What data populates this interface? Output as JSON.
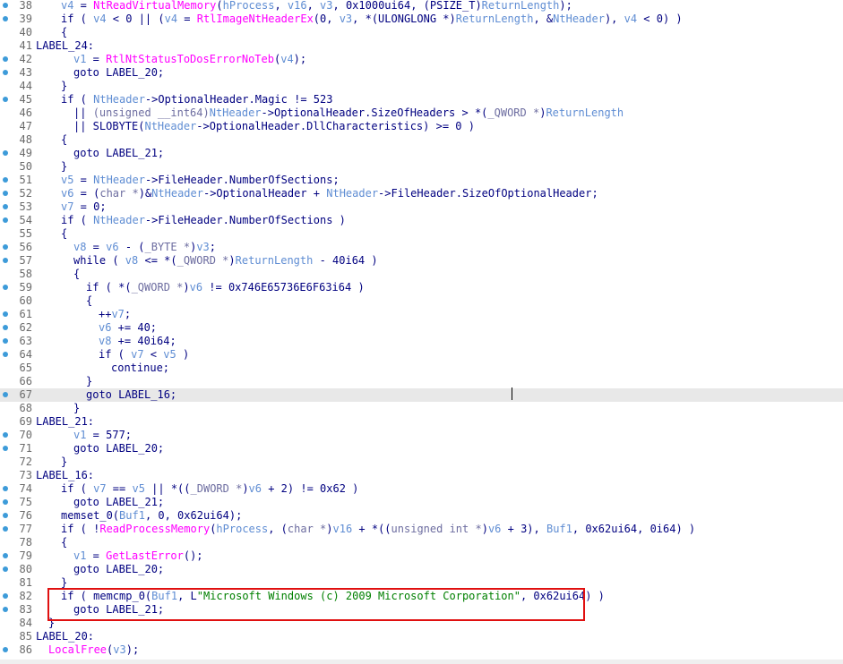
{
  "colors": {
    "keyword": "#000080",
    "variable": "#5f8dd3",
    "function": "#ff00ff",
    "string": "#008000",
    "breakpoint": "#3d9bd9",
    "highlight_box": "#e01010",
    "current_line": "#e8e8e8"
  },
  "icons": {
    "breakpoint": "breakpoint-dot-icon",
    "caret": "text-caret"
  },
  "annotation": {
    "type": "red-rectangle",
    "covers_lines": [
      "82",
      "83"
    ]
  },
  "current_line": "67",
  "lines": [
    {
      "num": "38",
      "bp": true,
      "indent": 2,
      "segs": [
        [
          "v",
          "v4"
        ],
        [
          "k",
          " = "
        ],
        [
          "f",
          "NtReadVirtualMemory"
        ],
        [
          "k",
          "("
        ],
        [
          "v",
          "hProcess"
        ],
        [
          "k",
          ", "
        ],
        [
          "v",
          "v16"
        ],
        [
          "k",
          ", "
        ],
        [
          "v",
          "v3"
        ],
        [
          "k",
          ", 0x1000ui64, (PSIZE_T)"
        ],
        [
          "v",
          "ReturnLength"
        ],
        [
          "k",
          ");"
        ]
      ]
    },
    {
      "num": "39",
      "bp": true,
      "indent": 2,
      "segs": [
        [
          "k",
          "if ( "
        ],
        [
          "v",
          "v4"
        ],
        [
          "k",
          " < 0 || ("
        ],
        [
          "v",
          "v4"
        ],
        [
          "k",
          " = "
        ],
        [
          "f",
          "RtlImageNtHeaderEx"
        ],
        [
          "k",
          "(0, "
        ],
        [
          "v",
          "v3"
        ],
        [
          "k",
          ", *(ULONGLONG *)"
        ],
        [
          "v",
          "ReturnLength"
        ],
        [
          "k",
          ", &"
        ],
        [
          "v",
          "NtHeader"
        ],
        [
          "k",
          "), "
        ],
        [
          "v",
          "v4"
        ],
        [
          "k",
          " < 0) )"
        ]
      ]
    },
    {
      "num": "40",
      "bp": false,
      "indent": 2,
      "segs": [
        [
          "k",
          "{"
        ]
      ]
    },
    {
      "num": "41",
      "bp": false,
      "indent": 0,
      "segs": [
        [
          "k",
          "LABEL_24:"
        ]
      ]
    },
    {
      "num": "42",
      "bp": true,
      "indent": 3,
      "segs": [
        [
          "v",
          "v1"
        ],
        [
          "k",
          " = "
        ],
        [
          "f",
          "RtlNtStatusToDosErrorNoTeb"
        ],
        [
          "k",
          "("
        ],
        [
          "v",
          "v4"
        ],
        [
          "k",
          ");"
        ]
      ]
    },
    {
      "num": "43",
      "bp": true,
      "indent": 3,
      "segs": [
        [
          "k",
          "goto LABEL_20;"
        ]
      ]
    },
    {
      "num": "44",
      "bp": false,
      "indent": 2,
      "segs": [
        [
          "k",
          "}"
        ]
      ]
    },
    {
      "num": "45",
      "bp": true,
      "indent": 2,
      "segs": [
        [
          "k",
          "if ( "
        ],
        [
          "v",
          "NtHeader"
        ],
        [
          "k",
          "->OptionalHeader.Magic != 523"
        ]
      ]
    },
    {
      "num": "46",
      "bp": false,
      "indent": 3,
      "segs": [
        [
          "k",
          "|| "
        ],
        [
          "t",
          "(unsigned __int64)"
        ],
        [
          "v",
          "NtHeader"
        ],
        [
          "k",
          "->OptionalHeader.SizeOfHeaders > *("
        ],
        [
          "t",
          "_QWORD *"
        ],
        [
          "k",
          ")"
        ],
        [
          "v",
          "ReturnLength"
        ]
      ]
    },
    {
      "num": "47",
      "bp": false,
      "indent": 3,
      "segs": [
        [
          "k",
          "|| SLOBYTE("
        ],
        [
          "v",
          "NtHeader"
        ],
        [
          "k",
          "->OptionalHeader.DllCharacteristics) >= 0 )"
        ]
      ]
    },
    {
      "num": "48",
      "bp": false,
      "indent": 2,
      "segs": [
        [
          "k",
          "{"
        ]
      ]
    },
    {
      "num": "49",
      "bp": true,
      "indent": 3,
      "segs": [
        [
          "k",
          "goto LABEL_21;"
        ]
      ]
    },
    {
      "num": "50",
      "bp": false,
      "indent": 2,
      "segs": [
        [
          "k",
          "}"
        ]
      ]
    },
    {
      "num": "51",
      "bp": true,
      "indent": 2,
      "segs": [
        [
          "v",
          "v5"
        ],
        [
          "k",
          " = "
        ],
        [
          "v",
          "NtHeader"
        ],
        [
          "k",
          "->FileHeader.NumberOfSections;"
        ]
      ]
    },
    {
      "num": "52",
      "bp": true,
      "indent": 2,
      "segs": [
        [
          "v",
          "v6"
        ],
        [
          "k",
          " = ("
        ],
        [
          "t",
          "char *"
        ],
        [
          "k",
          ")&"
        ],
        [
          "v",
          "NtHeader"
        ],
        [
          "k",
          "->OptionalHeader + "
        ],
        [
          "v",
          "NtHeader"
        ],
        [
          "k",
          "->FileHeader.SizeOfOptionalHeader;"
        ]
      ]
    },
    {
      "num": "53",
      "bp": true,
      "indent": 2,
      "segs": [
        [
          "v",
          "v7"
        ],
        [
          "k",
          " = 0;"
        ]
      ]
    },
    {
      "num": "54",
      "bp": true,
      "indent": 2,
      "segs": [
        [
          "k",
          "if ( "
        ],
        [
          "v",
          "NtHeader"
        ],
        [
          "k",
          "->FileHeader.NumberOfSections )"
        ]
      ]
    },
    {
      "num": "55",
      "bp": false,
      "indent": 2,
      "segs": [
        [
          "k",
          "{"
        ]
      ]
    },
    {
      "num": "56",
      "bp": true,
      "indent": 3,
      "segs": [
        [
          "v",
          "v8"
        ],
        [
          "k",
          " = "
        ],
        [
          "v",
          "v6"
        ],
        [
          "k",
          " - ("
        ],
        [
          "t",
          "_BYTE *"
        ],
        [
          "k",
          ")"
        ],
        [
          "v",
          "v3"
        ],
        [
          "k",
          ";"
        ]
      ]
    },
    {
      "num": "57",
      "bp": true,
      "indent": 3,
      "segs": [
        [
          "k",
          "while ( "
        ],
        [
          "v",
          "v8"
        ],
        [
          "k",
          " <= *("
        ],
        [
          "t",
          "_QWORD *"
        ],
        [
          "k",
          ")"
        ],
        [
          "v",
          "ReturnLength"
        ],
        [
          "k",
          " - 40i64 )"
        ]
      ]
    },
    {
      "num": "58",
      "bp": false,
      "indent": 3,
      "segs": [
        [
          "k",
          "{"
        ]
      ]
    },
    {
      "num": "59",
      "bp": true,
      "indent": 4,
      "segs": [
        [
          "k",
          "if ( *("
        ],
        [
          "t",
          "_QWORD *"
        ],
        [
          "k",
          ")"
        ],
        [
          "v",
          "v6"
        ],
        [
          "k",
          " != 0x746E65736E6F63i64 )"
        ]
      ]
    },
    {
      "num": "60",
      "bp": false,
      "indent": 4,
      "segs": [
        [
          "k",
          "{"
        ]
      ]
    },
    {
      "num": "61",
      "bp": true,
      "indent": 5,
      "segs": [
        [
          "k",
          "++"
        ],
        [
          "v",
          "v7"
        ],
        [
          "k",
          ";"
        ]
      ]
    },
    {
      "num": "62",
      "bp": true,
      "indent": 5,
      "segs": [
        [
          "v",
          "v6"
        ],
        [
          "k",
          " += 40;"
        ]
      ]
    },
    {
      "num": "63",
      "bp": true,
      "indent": 5,
      "segs": [
        [
          "v",
          "v8"
        ],
        [
          "k",
          " += 40i64;"
        ]
      ]
    },
    {
      "num": "64",
      "bp": true,
      "indent": 5,
      "segs": [
        [
          "k",
          "if ( "
        ],
        [
          "v",
          "v7"
        ],
        [
          "k",
          " < "
        ],
        [
          "v",
          "v5"
        ],
        [
          "k",
          " )"
        ]
      ]
    },
    {
      "num": "65",
      "bp": false,
      "indent": 6,
      "segs": [
        [
          "k",
          "continue;"
        ]
      ]
    },
    {
      "num": "66",
      "bp": false,
      "indent": 4,
      "segs": [
        [
          "k",
          "}"
        ]
      ]
    },
    {
      "num": "67",
      "bp": true,
      "indent": 4,
      "segs": [
        [
          "k",
          "goto LABEL_16;"
        ]
      ]
    },
    {
      "num": "68",
      "bp": false,
      "indent": 3,
      "segs": [
        [
          "k",
          "}"
        ]
      ]
    },
    {
      "num": "69",
      "bp": false,
      "indent": 0,
      "segs": [
        [
          "k",
          "LABEL_21:"
        ]
      ]
    },
    {
      "num": "70",
      "bp": true,
      "indent": 3,
      "segs": [
        [
          "v",
          "v1"
        ],
        [
          "k",
          " = 577;"
        ]
      ]
    },
    {
      "num": "71",
      "bp": true,
      "indent": 3,
      "segs": [
        [
          "k",
          "goto LABEL_20;"
        ]
      ]
    },
    {
      "num": "72",
      "bp": false,
      "indent": 2,
      "segs": [
        [
          "k",
          "}"
        ]
      ]
    },
    {
      "num": "73",
      "bp": false,
      "indent": 0,
      "segs": [
        [
          "k",
          "LABEL_16:"
        ]
      ]
    },
    {
      "num": "74",
      "bp": true,
      "indent": 2,
      "segs": [
        [
          "k",
          "if ( "
        ],
        [
          "v",
          "v7"
        ],
        [
          "k",
          " == "
        ],
        [
          "v",
          "v5"
        ],
        [
          "k",
          " || *(("
        ],
        [
          "t",
          "_DWORD *"
        ],
        [
          "k",
          ")"
        ],
        [
          "v",
          "v6"
        ],
        [
          "k",
          " + 2) != 0x62 )"
        ]
      ]
    },
    {
      "num": "75",
      "bp": true,
      "indent": 3,
      "segs": [
        [
          "k",
          "goto LABEL_21;"
        ]
      ]
    },
    {
      "num": "76",
      "bp": true,
      "indent": 2,
      "segs": [
        [
          "k",
          "memset_0("
        ],
        [
          "v",
          "Buf1"
        ],
        [
          "k",
          ", 0, 0x62ui64);"
        ]
      ]
    },
    {
      "num": "77",
      "bp": true,
      "indent": 2,
      "segs": [
        [
          "k",
          "if ( !"
        ],
        [
          "f",
          "ReadProcessMemory"
        ],
        [
          "k",
          "("
        ],
        [
          "v",
          "hProcess"
        ],
        [
          "k",
          ", ("
        ],
        [
          "t",
          "char *"
        ],
        [
          "k",
          ")"
        ],
        [
          "v",
          "v16"
        ],
        [
          "k",
          " + *(("
        ],
        [
          "t",
          "unsigned int *"
        ],
        [
          "k",
          ")"
        ],
        [
          "v",
          "v6"
        ],
        [
          "k",
          " + 3), "
        ],
        [
          "v",
          "Buf1"
        ],
        [
          "k",
          ", 0x62ui64, 0i64) )"
        ]
      ]
    },
    {
      "num": "78",
      "bp": false,
      "indent": 2,
      "segs": [
        [
          "k",
          "{"
        ]
      ]
    },
    {
      "num": "79",
      "bp": true,
      "indent": 3,
      "segs": [
        [
          "v",
          "v1"
        ],
        [
          "k",
          " = "
        ],
        [
          "f",
          "GetLastError"
        ],
        [
          "k",
          "();"
        ]
      ]
    },
    {
      "num": "80",
      "bp": true,
      "indent": 3,
      "segs": [
        [
          "k",
          "goto LABEL_20;"
        ]
      ]
    },
    {
      "num": "81",
      "bp": false,
      "indent": 2,
      "segs": [
        [
          "k",
          "}"
        ]
      ]
    },
    {
      "num": "82",
      "bp": true,
      "indent": 2,
      "segs": [
        [
          "k",
          "if ( memcmp_0("
        ],
        [
          "v",
          "Buf1"
        ],
        [
          "k",
          ", L"
        ],
        [
          "s",
          "\"Microsoft Windows (c) 2009 Microsoft Corporation\""
        ],
        [
          "k",
          ", 0x62ui64) )"
        ]
      ]
    },
    {
      "num": "83",
      "bp": true,
      "indent": 3,
      "segs": [
        [
          "k",
          "goto LABEL_21;"
        ]
      ]
    },
    {
      "num": "84",
      "bp": false,
      "indent": 1,
      "segs": [
        [
          "k",
          "}"
        ]
      ]
    },
    {
      "num": "85",
      "bp": false,
      "indent": 0,
      "segs": [
        [
          "k",
          "LABEL_20:"
        ]
      ]
    },
    {
      "num": "86",
      "bp": true,
      "indent": 1,
      "segs": [
        [
          "f",
          "LocalFree"
        ],
        [
          "k",
          "("
        ],
        [
          "v",
          "v3"
        ],
        [
          "k",
          ");"
        ]
      ]
    }
  ]
}
